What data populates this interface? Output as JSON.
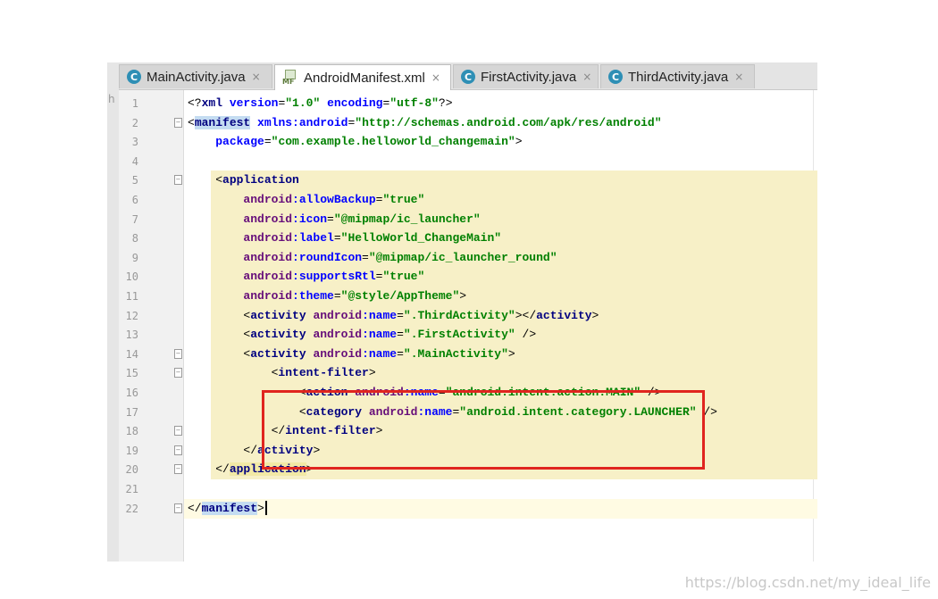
{
  "tabs": [
    {
      "label": "MainActivity.java",
      "icon": "java-class-icon",
      "icon_glyph": "C",
      "active": false
    },
    {
      "label": "AndroidManifest.xml",
      "icon": "manifest-file-icon",
      "icon_glyph": "MF",
      "active": true
    },
    {
      "label": "FirstActivity.java",
      "icon": "java-class-icon",
      "icon_glyph": "C",
      "active": false
    },
    {
      "label": "ThirdActivity.java",
      "icon": "java-class-icon",
      "icon_glyph": "C",
      "active": false
    }
  ],
  "close_glyph": "×",
  "left_panel_text": "h",
  "lines": [
    {
      "n": "1",
      "tokens": [
        [
          "punc",
          "<?"
        ],
        [
          "tag",
          "xml"
        ],
        [
          "punc",
          " "
        ],
        [
          "attr",
          "version"
        ],
        [
          "punc",
          "="
        ],
        [
          "val",
          "\"1.0\""
        ],
        [
          "punc",
          " "
        ],
        [
          "attr",
          "encoding"
        ],
        [
          "punc",
          "="
        ],
        [
          "val",
          "\"utf-8\""
        ],
        [
          "punc",
          "?>"
        ]
      ]
    },
    {
      "n": "2",
      "tokens": [
        [
          "punc",
          "<"
        ],
        [
          "tag",
          "manifest"
        ],
        [
          "punc",
          " "
        ],
        [
          "attr",
          "xmlns:android"
        ],
        [
          "punc",
          "="
        ],
        [
          "val",
          "\"http://schemas.android.com/apk/res/android\""
        ]
      ]
    },
    {
      "n": "3",
      "tokens": [
        [
          "punc",
          "    "
        ],
        [
          "attr",
          "package"
        ],
        [
          "punc",
          "="
        ],
        [
          "val",
          "\"com.example.helloworld_changemain\""
        ],
        [
          "punc",
          ">"
        ]
      ]
    },
    {
      "n": "4",
      "tokens": []
    },
    {
      "n": "5",
      "tokens": [
        [
          "punc",
          "    <"
        ],
        [
          "tag",
          "application"
        ]
      ]
    },
    {
      "n": "6",
      "tokens": [
        [
          "punc",
          "        "
        ],
        [
          "ns",
          "android"
        ],
        [
          "attr",
          ":allowBackup"
        ],
        [
          "punc",
          "="
        ],
        [
          "val",
          "\"true\""
        ]
      ]
    },
    {
      "n": "7",
      "tokens": [
        [
          "punc",
          "        "
        ],
        [
          "ns",
          "android"
        ],
        [
          "attr",
          ":icon"
        ],
        [
          "punc",
          "="
        ],
        [
          "val",
          "\"@mipmap/ic_launcher\""
        ]
      ]
    },
    {
      "n": "8",
      "tokens": [
        [
          "punc",
          "        "
        ],
        [
          "ns",
          "android"
        ],
        [
          "attr",
          ":label"
        ],
        [
          "punc",
          "="
        ],
        [
          "val",
          "\"HelloWorld_ChangeMain\""
        ]
      ]
    },
    {
      "n": "9",
      "tokens": [
        [
          "punc",
          "        "
        ],
        [
          "ns",
          "android"
        ],
        [
          "attr",
          ":roundIcon"
        ],
        [
          "punc",
          "="
        ],
        [
          "val",
          "\"@mipmap/ic_launcher_round\""
        ]
      ]
    },
    {
      "n": "10",
      "tokens": [
        [
          "punc",
          "        "
        ],
        [
          "ns",
          "android"
        ],
        [
          "attr",
          ":supportsRtl"
        ],
        [
          "punc",
          "="
        ],
        [
          "val",
          "\"true\""
        ]
      ]
    },
    {
      "n": "11",
      "tokens": [
        [
          "punc",
          "        "
        ],
        [
          "ns",
          "android"
        ],
        [
          "attr",
          ":theme"
        ],
        [
          "punc",
          "="
        ],
        [
          "val",
          "\"@style/AppTheme\""
        ],
        [
          "punc",
          ">"
        ]
      ]
    },
    {
      "n": "12",
      "tokens": [
        [
          "punc",
          "        <"
        ],
        [
          "tag",
          "activity"
        ],
        [
          "punc",
          " "
        ],
        [
          "ns",
          "android"
        ],
        [
          "attr",
          ":name"
        ],
        [
          "punc",
          "="
        ],
        [
          "val",
          "\".ThirdActivity\""
        ],
        [
          "punc",
          "></"
        ],
        [
          "tag",
          "activity"
        ],
        [
          "punc",
          ">"
        ]
      ]
    },
    {
      "n": "13",
      "tokens": [
        [
          "punc",
          "        <"
        ],
        [
          "tag",
          "activity"
        ],
        [
          "punc",
          " "
        ],
        [
          "ns",
          "android"
        ],
        [
          "attr",
          ":name"
        ],
        [
          "punc",
          "="
        ],
        [
          "val",
          "\".FirstActivity\""
        ],
        [
          "punc",
          " />"
        ]
      ]
    },
    {
      "n": "14",
      "tokens": [
        [
          "punc",
          "        <"
        ],
        [
          "tag",
          "activity"
        ],
        [
          "punc",
          " "
        ],
        [
          "ns",
          "android"
        ],
        [
          "attr",
          ":name"
        ],
        [
          "punc",
          "="
        ],
        [
          "val",
          "\".MainActivity\""
        ],
        [
          "punc",
          ">"
        ]
      ]
    },
    {
      "n": "15",
      "tokens": [
        [
          "punc",
          "            <"
        ],
        [
          "tag",
          "intent-filter"
        ],
        [
          "punc",
          ">"
        ]
      ]
    },
    {
      "n": "16",
      "tokens": [
        [
          "punc",
          "                <"
        ],
        [
          "tag",
          "action"
        ],
        [
          "punc",
          " "
        ],
        [
          "ns",
          "android"
        ],
        [
          "attr",
          ":name"
        ],
        [
          "punc",
          "="
        ],
        [
          "val",
          "\"android.intent.action.MAIN\""
        ],
        [
          "punc",
          " />"
        ]
      ]
    },
    {
      "n": "17",
      "tokens": [
        [
          "punc",
          "                <"
        ],
        [
          "tag",
          "category"
        ],
        [
          "punc",
          " "
        ],
        [
          "ns",
          "android"
        ],
        [
          "attr",
          ":name"
        ],
        [
          "punc",
          "="
        ],
        [
          "val",
          "\"android.intent.category.LAUNCHER\""
        ],
        [
          "punc",
          " />"
        ]
      ]
    },
    {
      "n": "18",
      "tokens": [
        [
          "punc",
          "            </"
        ],
        [
          "tag",
          "intent-filter"
        ],
        [
          "punc",
          ">"
        ]
      ]
    },
    {
      "n": "19",
      "tokens": [
        [
          "punc",
          "        </"
        ],
        [
          "tag",
          "activity"
        ],
        [
          "punc",
          ">"
        ]
      ]
    },
    {
      "n": "20",
      "tokens": [
        [
          "punc",
          "    </"
        ],
        [
          "tag",
          "application"
        ],
        [
          "punc",
          ">"
        ]
      ]
    },
    {
      "n": "21",
      "tokens": []
    },
    {
      "n": "22",
      "tokens": [
        [
          "punc",
          "</"
        ],
        [
          "tag",
          "manifest"
        ],
        [
          "punc",
          ">"
        ]
      ]
    }
  ],
  "current_line": "22",
  "watermark": "https://blog.csdn.net/my_ideal_life",
  "colors": {
    "highlight_box": "#e0251f",
    "block_highlight": "#f7f0c7",
    "string": "#008000",
    "tag": "#000080",
    "namespace": "#660e7a",
    "attribute": "#0000ff"
  }
}
